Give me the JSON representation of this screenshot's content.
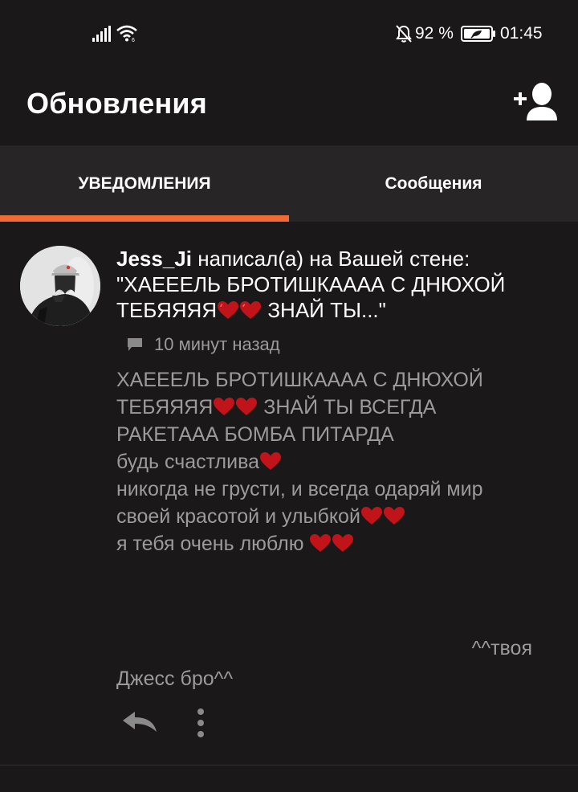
{
  "status_bar": {
    "battery_percent": "92 %",
    "time": "01:45",
    "icons": [
      "signal-icon",
      "wifi-icon",
      "mute-notifications-icon",
      "battery-icon"
    ]
  },
  "header": {
    "title": "Обновления",
    "add_friend_icon": "add-person-icon"
  },
  "tabs": [
    {
      "label": "УВЕДОМЛЕНИЯ",
      "active": true
    },
    {
      "label": "Сообщения",
      "active": false
    }
  ],
  "colors": {
    "background": "#1a1819",
    "tab_bar": "#272526",
    "accent": "#f06a33",
    "secondary_text": "#9b9b9b",
    "heart": "#c0131a"
  },
  "notification": {
    "username": "Jess_Ji",
    "action_text": " написал(а) на Вашей стене:",
    "quote_line1": "\"ХАЕЕЕЛЬ БРОТИШКАААА С ДНЮХОЙ",
    "quote_line2_text": "ТЕБЯЯЯЯ",
    "quote_line2_end": " ЗНАЙ ТЫ...\"",
    "time_ago": "10 минут назад",
    "body": {
      "line1": "ХАЕЕЕЛЬ БРОТИШКАААА С ДНЮХОЙ",
      "line2a": "ТЕБЯЯЯЯ",
      "line2b": " ЗНАЙ ТЫ ВСЕГДА",
      "line3": "РАКЕТААА БОМБА  ПИТАРДА",
      "line4": "будь счастлива",
      "line5": "никогда не грусти, и всегда одаряй мир",
      "line6": "своей красотой и улыбкой",
      "line7": "я тебя очень люблю "
    },
    "signature_line1": "^^твоя",
    "signature_line2": "Джесс бро^^",
    "actions": [
      "reply-icon",
      "more-options-icon"
    ]
  }
}
